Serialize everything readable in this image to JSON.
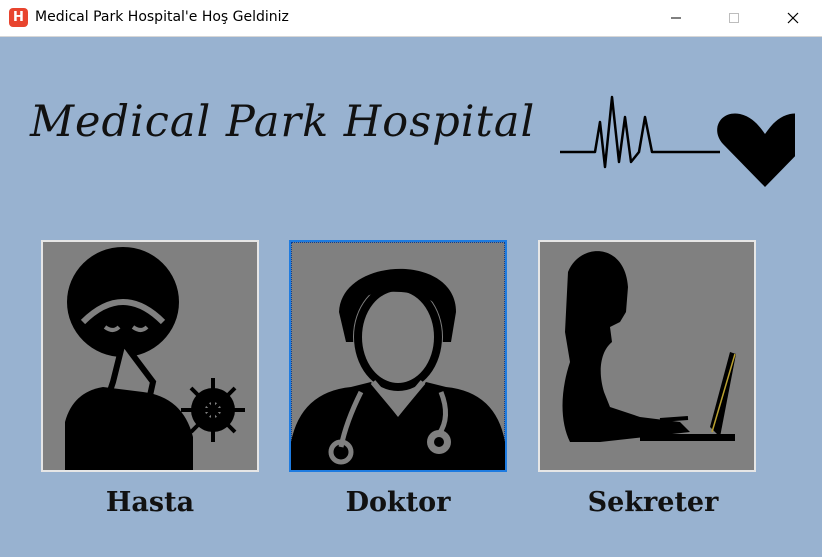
{
  "window": {
    "title": "Medical Park Hospital'e Hoş Geldiniz",
    "app_icon_letter": "H"
  },
  "banner": {
    "title": "Medical Park Hospital",
    "decoration": "heartbeat-heart-icon"
  },
  "roles": [
    {
      "label": "Hasta",
      "icon": "patient-sneezing-icon",
      "selected": false
    },
    {
      "label": "Doktor",
      "icon": "doctor-stethoscope-icon",
      "selected": true
    },
    {
      "label": "Sekreter",
      "icon": "secretary-laptop-icon",
      "selected": false
    }
  ],
  "colors": {
    "background": "#98b2d0",
    "tile": "#808080",
    "selected_border": "#1e7be0",
    "app_icon": "#e8442e"
  }
}
